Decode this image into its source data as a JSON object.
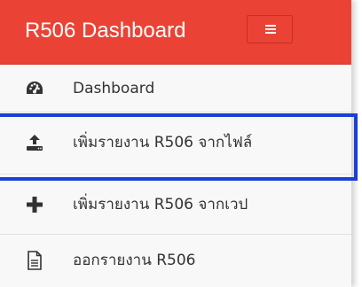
{
  "header": {
    "title": "R506 Dashboard",
    "menu_toggle_icon": "hamburger-icon",
    "background_color": "#ea4335"
  },
  "menu": {
    "items": [
      {
        "label": "Dashboard",
        "icon": "dashboard-gauge-icon"
      },
      {
        "label": "เพิ่มรายงาน R506 จากไฟล์",
        "icon": "upload-icon",
        "highlighted": true
      },
      {
        "label": "เพิ่มรายงาน R506 จากเวป",
        "icon": "plus-icon"
      },
      {
        "label": "ออกรายงาน R506",
        "icon": "document-icon"
      }
    ]
  },
  "highlight_color": "#1a3fd6"
}
